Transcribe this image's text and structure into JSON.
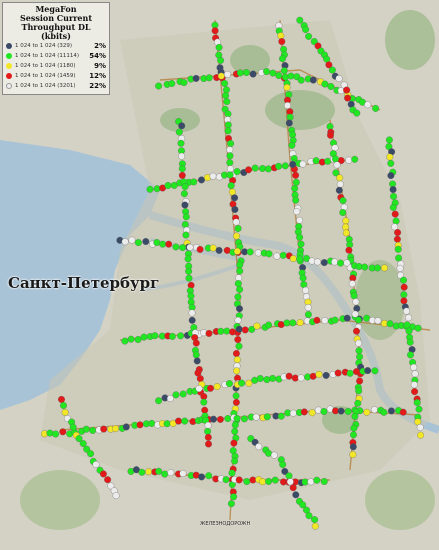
{
  "legend": {
    "title_lines": [
      "MegaFon",
      "Session Current",
      "Throughput DL (kbits)"
    ],
    "items": [
      {
        "range": "1 024 to 1 024 (329)",
        "percent": "2%",
        "color": "#3b4a66"
      },
      {
        "range": "1 024 to 1 024 (11114)",
        "percent": "54%",
        "color": "#22e622"
      },
      {
        "range": "1 024 to 1 024 (1180)",
        "percent": "9%",
        "color": "#f2e629"
      },
      {
        "range": "1 024 to 1 024 (1459)",
        "percent": "12%",
        "color": "#e21a1a"
      },
      {
        "range": "1 024 to 1 024 (3201)",
        "percent": "22%",
        "color": "#ececec"
      }
    ]
  },
  "map": {
    "city_label": "Санкт-Петербург",
    "bottom_label": "ЖЕЛЕЗНОДОРОЖН"
  }
}
